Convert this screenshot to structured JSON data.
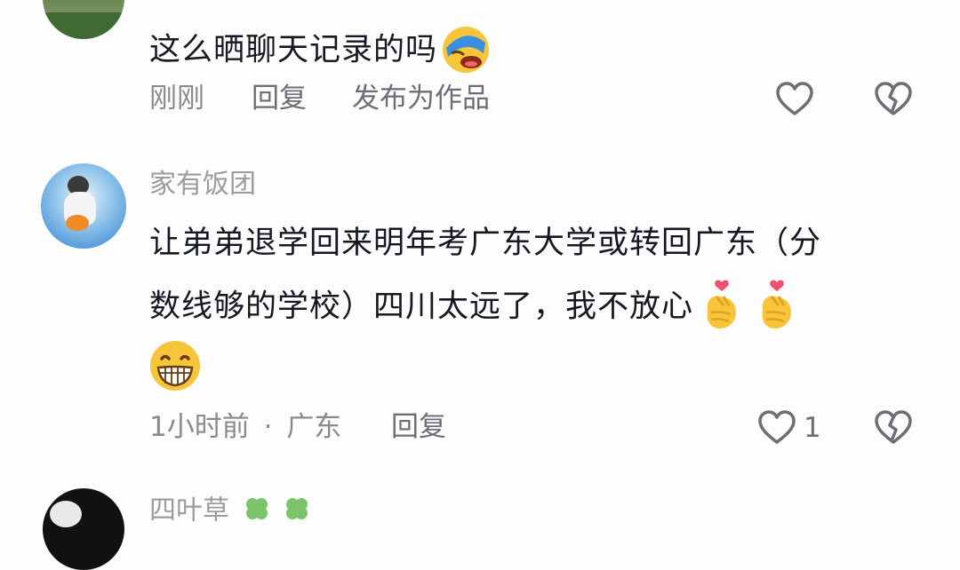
{
  "comments": [
    {
      "text": "这么晒聊天记录的吗",
      "emoji": "facepalm-laugh-emoji",
      "time": "刚刚",
      "reply_label": "回复",
      "publish_label": "发布为作品"
    },
    {
      "username": "家有饭团",
      "line1": "让弟弟退学回来明年考广东大学或转回广东（分",
      "line2": "数线够的学校）四川太远了，我不放心",
      "emojis": [
        "finger-heart-emoji",
        "finger-heart-emoji",
        "grinning-emoji"
      ],
      "time": "1小时前",
      "separator": "·",
      "location": "广东",
      "reply_label": "回复",
      "like_count": "1"
    },
    {
      "username": "四叶草",
      "emojis": [
        "clover-emoji",
        "clover-emoji"
      ]
    }
  ],
  "icons": {
    "like": "heart-outline-icon",
    "dislike": "broken-heart-icon"
  },
  "colors": {
    "text": "#161823",
    "meta": "#8a8b91",
    "icon": "#6d6e75",
    "background": "#fdfdfd"
  }
}
